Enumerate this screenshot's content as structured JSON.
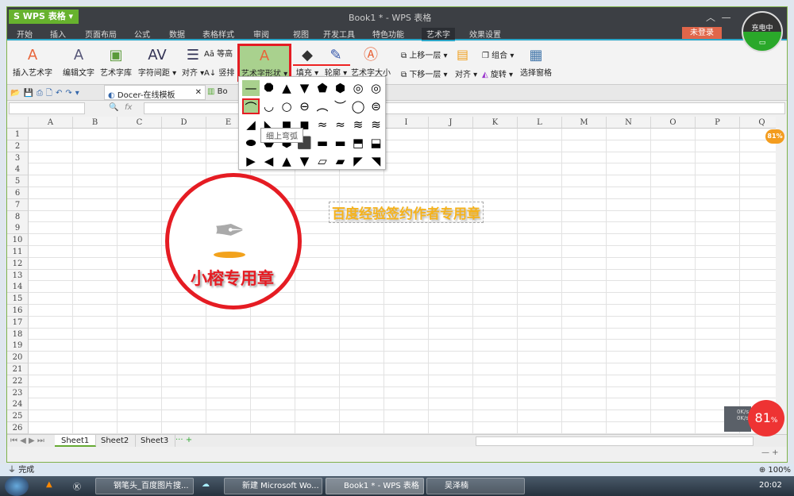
{
  "app": {
    "name": "WPS 表格",
    "title": "Book1 * - WPS 表格"
  },
  "menu": [
    "开始",
    "插入",
    "页面布局",
    "公式",
    "数据",
    "表格样式",
    "审阅",
    "视图",
    "开发工具",
    "特色功能",
    "艺术字",
    "效果设置"
  ],
  "active_menu": "艺术字",
  "login": "未登录",
  "ribbon": {
    "insert_wordart": "插入艺术字",
    "edit_text": "编辑文字",
    "wordart_library": "艺术字库",
    "char_spacing": "字符间距",
    "align": "对齐",
    "equal_height": "等高",
    "vertical": "竖排",
    "wordart_shape": "艺术字形状",
    "fill": "填充",
    "outline": "轮廓",
    "wordart_size": "艺术字大小",
    "bring_forward": "上移一层",
    "send_backward": "下移一层",
    "align2": "对齐",
    "group": "组合",
    "rotate": "旋转",
    "selection_pane": "选择窗格"
  },
  "doc_tabs": [
    "Docer-在线模板",
    "Bo"
  ],
  "formula": {
    "fx": "fx",
    "name_box": ""
  },
  "columns": [
    "A",
    "B",
    "C",
    "D",
    "E",
    "F",
    "G",
    "H",
    "I",
    "J",
    "K",
    "L",
    "M",
    "N",
    "O",
    "P",
    "Q"
  ],
  "rows": [
    "1",
    "2",
    "3",
    "4",
    "5",
    "6",
    "7",
    "8",
    "9",
    "10",
    "11",
    "12",
    "13",
    "14",
    "15",
    "16",
    "17",
    "18",
    "19",
    "20",
    "21",
    "22",
    "23",
    "24",
    "25",
    "26"
  ],
  "gallery": {
    "tooltip": "细上弯弧",
    "selected": "细上弯弧",
    "shapes": [
      "—",
      "⯃",
      "▲",
      "▼",
      "⬟",
      "⬢",
      "◎",
      "◎",
      "⌒",
      "◡",
      "○",
      "⊖",
      "︵",
      "︶",
      "◯",
      "⊜",
      "◢",
      "◣",
      "◼",
      "◼",
      "≈",
      "≈",
      "≋",
      "≋",
      "⬬",
      "⬣",
      "⬢",
      "⬛",
      "▬",
      "▬",
      "⬒",
      "⬓",
      "▶",
      "◀",
      "▲",
      "▼",
      "▱",
      "▰",
      "◤",
      "◥"
    ]
  },
  "stamp": {
    "text": "小榕专用章",
    "color": "#e51c23"
  },
  "wordart": {
    "text": "百度经验签约作者专用章",
    "color": "#f5b21c"
  },
  "sheets": [
    "Sheet1",
    "Sheet2",
    "Sheet3"
  ],
  "status": {
    "text": "完成",
    "zoom": "100%"
  },
  "battery": {
    "label": "充电中"
  },
  "widget": {
    "percent": "81",
    "unit": "%",
    "up": "0K/s",
    "down": "0K/s"
  },
  "taskbar": {
    "items": [
      "钢笔头_百度图片搜...",
      "新建 Microsoft Wo...",
      "Book1 * - WPS 表格",
      "吴泽楠"
    ],
    "clock": "20:02"
  }
}
